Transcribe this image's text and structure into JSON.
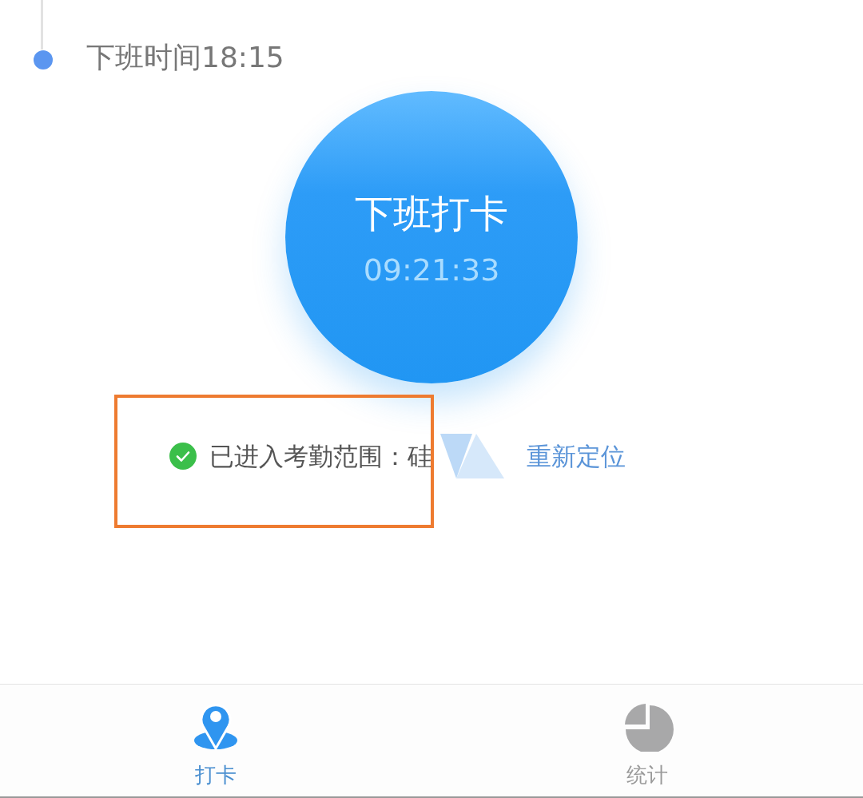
{
  "timeline": {
    "label": "下班时间18:15"
  },
  "punch_button": {
    "label": "下班打卡",
    "time": "09:21:33"
  },
  "location_status": {
    "in_range": true,
    "text": "已进入考勤范围：硅",
    "link": "重新定位"
  },
  "tabs": [
    {
      "label": "打卡",
      "kind": "pin",
      "selected": true
    },
    {
      "label": "统计",
      "kind": "pie",
      "selected": false
    }
  ]
}
